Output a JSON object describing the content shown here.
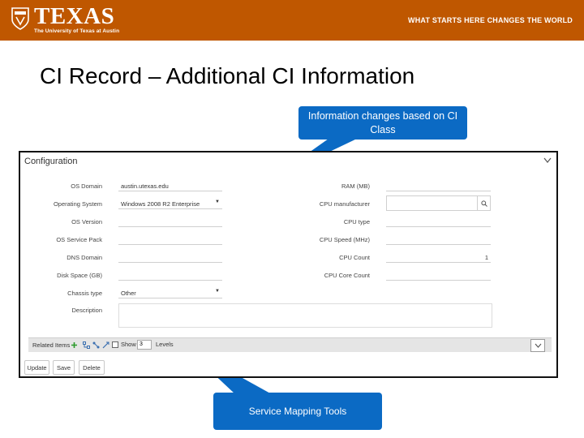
{
  "header": {
    "logo_word": "TEXAS",
    "logo_sub": "The University of Texas at Austin",
    "tagline": "WHAT STARTS HERE CHANGES THE WORLD"
  },
  "slide": {
    "title": "CI Record – Additional CI Information"
  },
  "callouts": {
    "top": "Information changes based on CI Class",
    "bottom": "Service Mapping Tools"
  },
  "config": {
    "header": "Configuration",
    "left_fields": [
      {
        "label": "OS Domain",
        "value": "austin.utexas.edu"
      },
      {
        "label": "Operating System",
        "value": "Windows 2008 R2 Enterprise"
      },
      {
        "label": "OS Version",
        "value": ""
      },
      {
        "label": "OS Service Pack",
        "value": ""
      },
      {
        "label": "DNS Domain",
        "value": ""
      },
      {
        "label": "Disk Space (GB)",
        "value": ""
      },
      {
        "label": "Chassis type",
        "value": "Other"
      },
      {
        "label": "Description",
        "value": ""
      }
    ],
    "right_fields": [
      {
        "label": "RAM (MB)",
        "value": ""
      },
      {
        "label": "CPU manufacturer",
        "value": ""
      },
      {
        "label": "CPU type",
        "value": ""
      },
      {
        "label": "CPU Speed (MHz)",
        "value": ""
      },
      {
        "label": "CPU Count",
        "value": "1"
      },
      {
        "label": "CPU Core Count",
        "value": ""
      }
    ]
  },
  "related": {
    "label": "Related Items",
    "show_label": "Show",
    "level_value": "3",
    "levels_label": "Levels"
  },
  "buttons": {
    "update": "Update",
    "save": "Save",
    "delete": "Delete"
  },
  "colors": {
    "brand_orange": "#bf5700",
    "callout_blue": "#0b6ac4"
  }
}
